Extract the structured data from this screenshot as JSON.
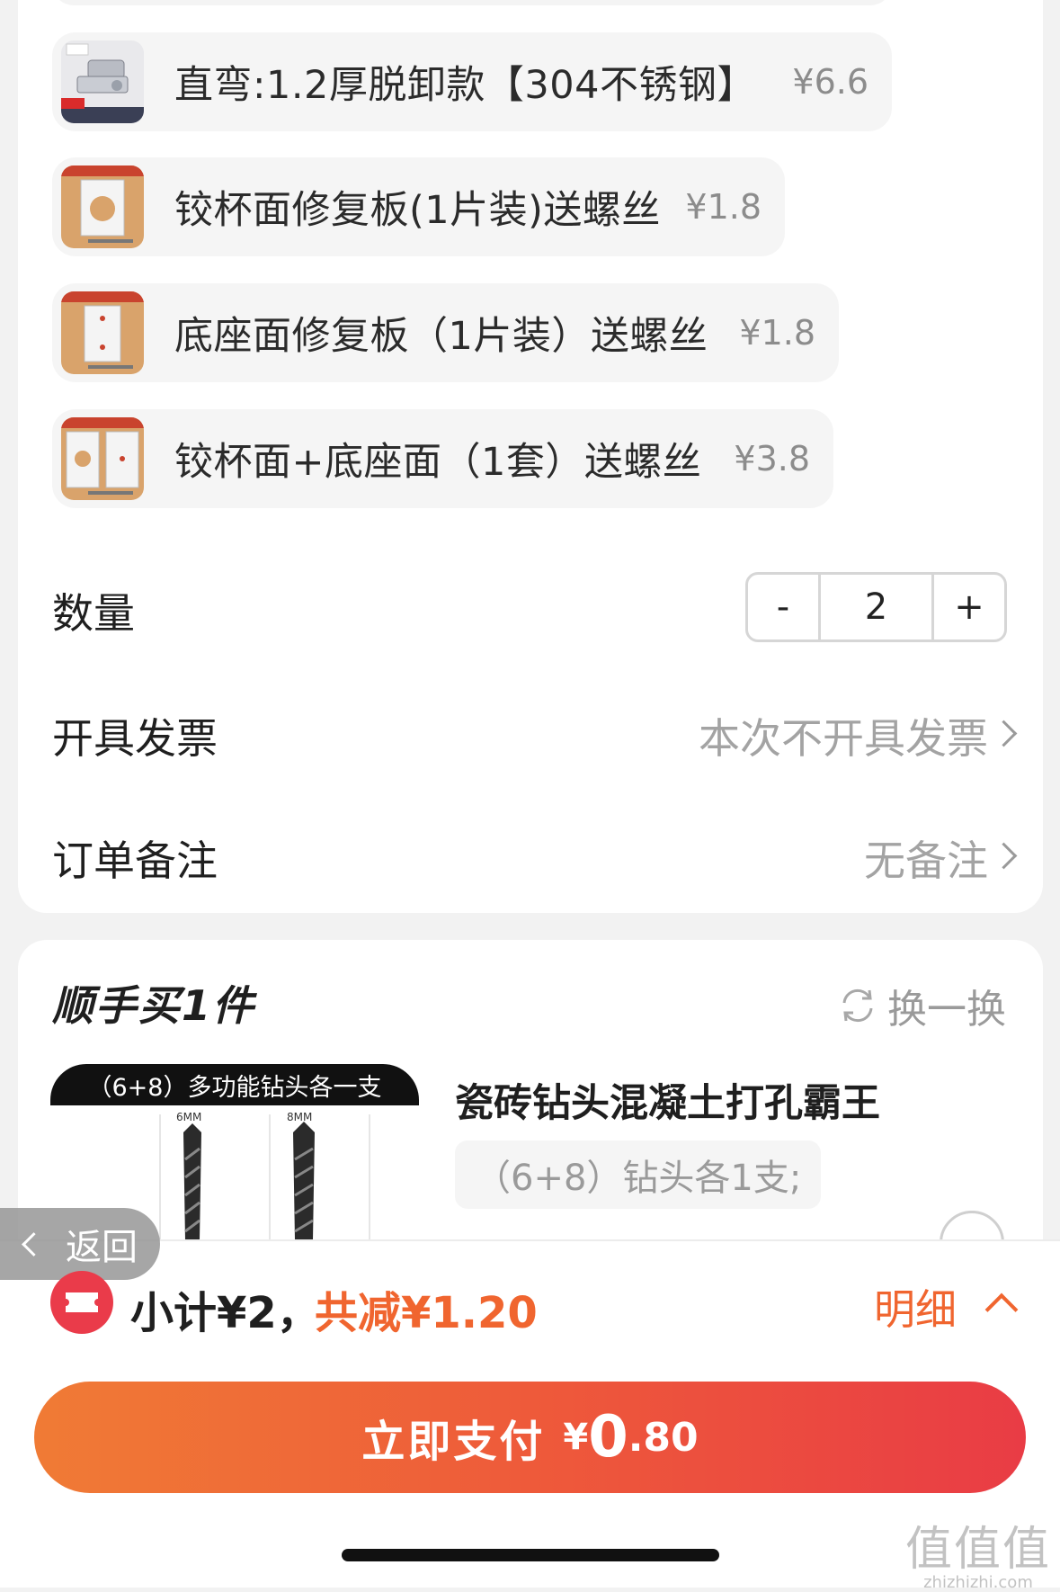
{
  "sku_options": [
    {
      "name": "直弯:1.2厚脱卸款【304不锈钢】",
      "price": "¥6.6",
      "thumb": "hinge"
    },
    {
      "name": "铰杯面修复板(1片装)送螺丝",
      "price": "¥1.8",
      "thumb": "plate-1"
    },
    {
      "name": "底座面修复板（1片装）送螺丝",
      "price": "¥1.8",
      "thumb": "plate-2"
    },
    {
      "name": "铰杯面+底座面（1套）送螺丝",
      "price": "¥3.8",
      "thumb": "plate-3"
    }
  ],
  "quantity": {
    "label": "数量",
    "minus": "-",
    "value": "2",
    "plus": "+"
  },
  "invoice": {
    "label": "开具发票",
    "value": "本次不开具发票"
  },
  "remark": {
    "label": "订单备注",
    "value": "无备注"
  },
  "addon": {
    "title": "顺手买1件",
    "swap_label": "换一换",
    "image_banner": "（6+8）多功能钻头各一支",
    "image_size_a": "6MM",
    "image_size_b": "8MM",
    "product_title": "瓷砖钻头混凝土打孔霸王",
    "spec": "（6+8）钻头各1支;"
  },
  "back_label": "返回",
  "summary": {
    "subtotal": "小计¥2，",
    "discount": "共减¥1.20",
    "detail": "明细"
  },
  "pay": {
    "label": "立即支付",
    "currency": "¥",
    "integer": "0",
    "decimal": ".80"
  },
  "watermark": {
    "glyphs": "值值值",
    "site": "zhizhizhi.com"
  },
  "colors": {
    "accent": "#f0652f",
    "pay_start": "#f07b35",
    "pay_end": "#e93c45",
    "coupon": "#ea3b4a"
  }
}
